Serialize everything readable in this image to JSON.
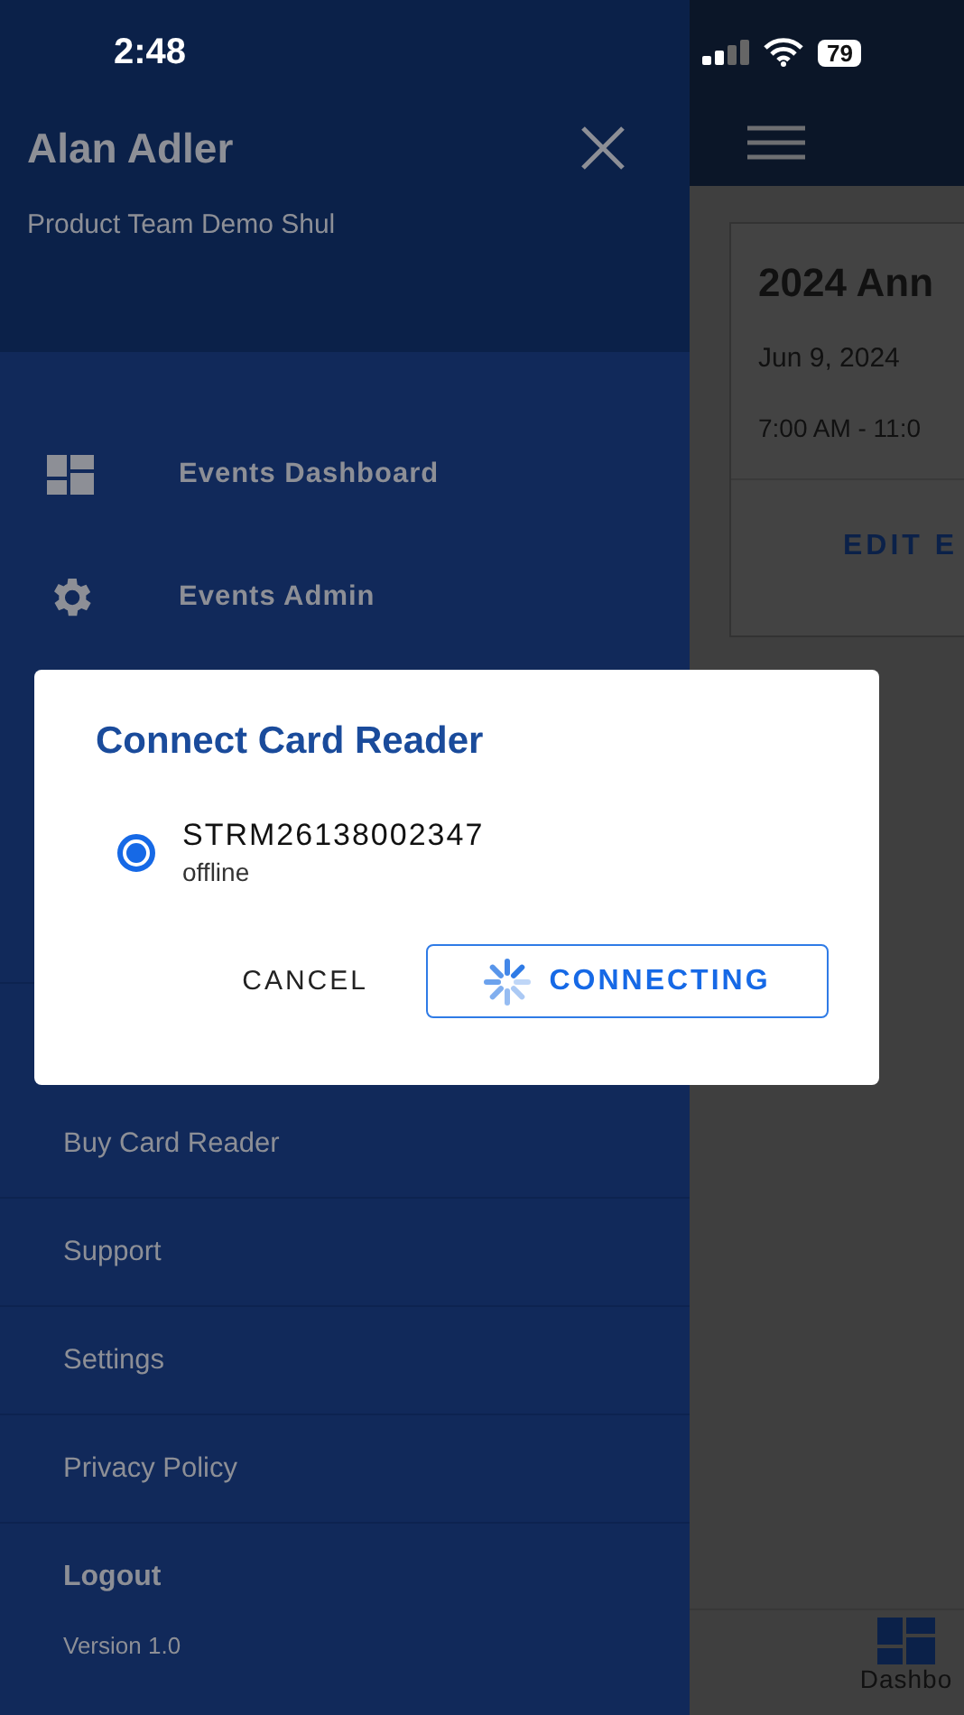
{
  "status_bar": {
    "time": "2:48",
    "battery": "79"
  },
  "drawer": {
    "user_name": "Alan Adler",
    "organization": "Product Team Demo Shul",
    "nav_items": [
      {
        "label": "Events Dashboard",
        "kind": "dashboard"
      },
      {
        "label": "Events Admin",
        "kind": "gear"
      }
    ],
    "links": [
      "Buy Card Reader",
      "Support",
      "Settings",
      "Privacy Policy"
    ],
    "logout": "Logout",
    "version": "Version 1.0"
  },
  "background": {
    "event_card": {
      "title": "2024 Ann",
      "date": "Jun 9, 2024",
      "time": "7:00 AM - 11:0",
      "action": "EDIT E"
    },
    "tab_label": "Dashbo"
  },
  "dialog": {
    "title": "Connect Card Reader",
    "readers": [
      {
        "name": "STRM26138002347",
        "status": "offline",
        "selected": true
      }
    ],
    "cancel": "CANCEL",
    "connect": {
      "label": "CONNECTING",
      "busy": true
    }
  }
}
